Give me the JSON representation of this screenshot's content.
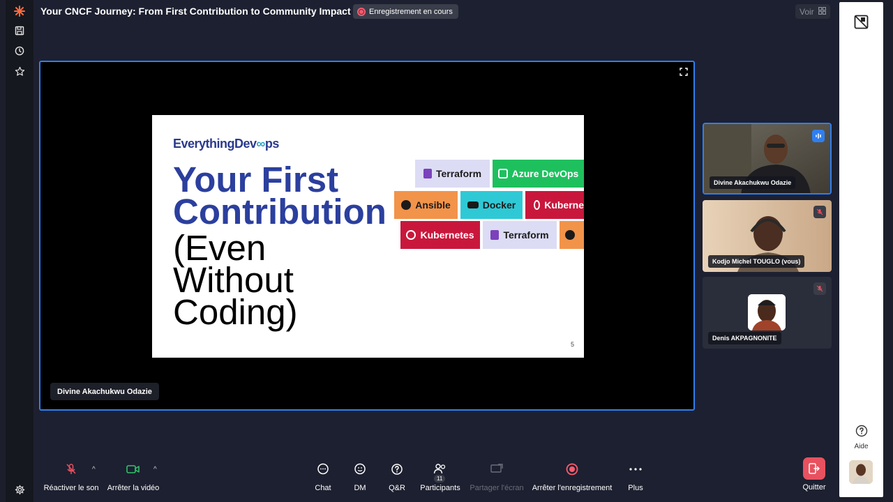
{
  "meeting": {
    "title": "Your CNCF Journey: From First Contribution to Community Impact",
    "recording_label": "Enregistrement en cours",
    "view_label": "Voir"
  },
  "colors": {
    "accent": "#2f7ff0",
    "recording": "#ff5a6e",
    "quit": "#e8515f"
  },
  "sidebar": {
    "icons": [
      "app-logo-icon",
      "save-icon",
      "clock-icon",
      "star-icon",
      "settings-icon"
    ]
  },
  "share": {
    "presenter_name": "Divine Akachukwu Odazie",
    "slide": {
      "logo_text_a": "EverythingDev",
      "logo_text_b": "ps",
      "title_line1": "Your First",
      "title_line2": "Contribution",
      "body_line1": "(Even",
      "body_line2": "Without",
      "body_line3": "Coding)",
      "page_number": "5",
      "tiles": [
        {
          "label": "Terraform",
          "bg": "#dcdcf5",
          "fg": "#1a1a1a"
        },
        {
          "label": "Azure DevOps",
          "bg": "#1ec05e",
          "fg": "#ffffff"
        },
        {
          "label": "Ansible",
          "bg": "#f2934a",
          "fg": "#1a1a1a"
        },
        {
          "label": "Docker",
          "bg": "#2fc9d6",
          "fg": "#1a1a1a"
        },
        {
          "label": "Kuberne",
          "bg": "#c9173c",
          "fg": "#ffffff"
        },
        {
          "label": "Kubernetes",
          "bg": "#c9173c",
          "fg": "#ffffff"
        },
        {
          "label": "Terraform",
          "bg": "#dcdcf5",
          "fg": "#1a1a1a"
        },
        {
          "label": "",
          "bg": "#f2934a",
          "fg": "#1a1a1a"
        }
      ]
    }
  },
  "participants": [
    {
      "name": "Divine Akachukwu Odazie",
      "state": "speaking"
    },
    {
      "name": "Kodjo Michel TOUGLO (vous)",
      "state": "muted"
    },
    {
      "name": "Denis AKPAGNONITE",
      "state": "muted"
    }
  ],
  "toolbar": {
    "unmute": "Réactiver le son",
    "stop_video": "Arrêter la vidéo",
    "chat": "Chat",
    "dm": "DM",
    "qa": "Q&R",
    "participants": "Participants",
    "participants_count": "11",
    "share_screen": "Partager l'écran",
    "stop_recording": "Arrêter l'enregistrement",
    "more": "Plus",
    "quit": "Quitter"
  },
  "right_panel": {
    "help": "Aide"
  }
}
